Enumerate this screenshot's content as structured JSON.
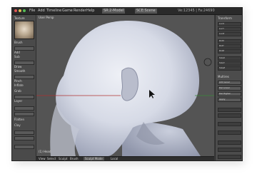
{
  "menubar": {
    "items": [
      "File",
      "Add",
      "Timeline",
      "Game",
      "Render",
      "Help"
    ],
    "screen_selector": "SR:2-Model",
    "scene_selector": "SCE:Scene",
    "stats": "Ve:12345 | Fa:24690"
  },
  "left_panel": {
    "header": "Texture",
    "brush_label": "Brush",
    "items": [
      "Add",
      "Sub",
      "Draw",
      "Smooth",
      "Pinch",
      "Inflate",
      "Grab",
      "Layer",
      "Flatten",
      "Clay"
    ]
  },
  "viewport": {
    "label": "User Persp",
    "object_name": "(1) Head"
  },
  "right_panel": {
    "header": "Transform",
    "fields": [
      "LocX",
      "LocY",
      "LocZ",
      "RotX",
      "RotY",
      "RotZ",
      "SizeX",
      "SizeY",
      "SizeZ"
    ],
    "multires_header": "Multires",
    "buttons": [
      "Add Level",
      "Del Lower",
      "Del Higher",
      "Apply"
    ]
  },
  "bottombar": {
    "items": [
      "View",
      "Select",
      "Sculpt",
      "Brush",
      "Sculpt Mode",
      "Local"
    ]
  },
  "colors": {
    "viewport_bg": "#545454",
    "mesh": "#d9dde8",
    "axis_red": "#b03030",
    "axis_green": "#3a8a3a"
  }
}
